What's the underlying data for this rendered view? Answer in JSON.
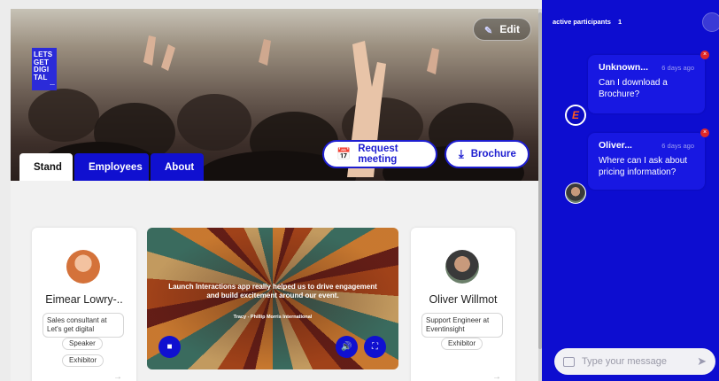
{
  "header": {
    "edit_label": "Edit",
    "logo_lines": [
      "LETS",
      "GET",
      "DIGI",
      "TAL"
    ],
    "logo_dots": "..."
  },
  "actions": {
    "request_meeting_label": "Request meeting",
    "brochure_label": "Brochure"
  },
  "tabs": [
    {
      "label": "Stand",
      "active": true
    },
    {
      "label": "Employees",
      "active": false
    },
    {
      "label": "About",
      "active": false
    }
  ],
  "people": [
    {
      "name": "Eimear Lowry-..",
      "title": "Sales consultant at Let's get digital",
      "badges": [
        "Speaker",
        "Exhibitor"
      ]
    },
    {
      "name": "Oliver Willmot",
      "title": "Support Engineer at Eventinsight",
      "badges": [
        "Exhibitor"
      ]
    }
  ],
  "video": {
    "quote": "Launch Interactions app really helped us to drive engagement and build excitement around our event.",
    "attribution": "Tracy - Phillip Morris International"
  },
  "chat": {
    "participants_label": "active participants",
    "participants_count": "1",
    "messages": [
      {
        "author": "Unknown...",
        "time": "6 days ago",
        "text": "Can I download a Brochure?"
      },
      {
        "author": "Oliver...",
        "time": "6 days ago",
        "text": "Where can I ask about pricing information?"
      }
    ],
    "input_placeholder": "Type your message"
  },
  "colors": {
    "accent": "#1010d0",
    "chat_bg": "#0d0dd0",
    "delete_badge": "#e02828"
  }
}
